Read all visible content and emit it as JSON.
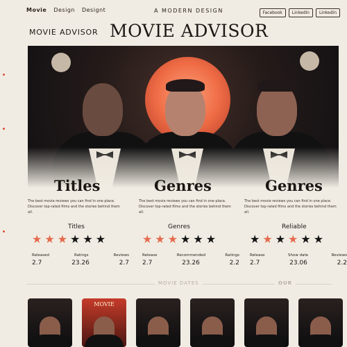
{
  "nav": {
    "items": [
      "Movie",
      "Design",
      "Designt"
    ],
    "tagline": "A MODERN DESIGN",
    "social": [
      "Facebook",
      "LinkedIn",
      "Linkedin"
    ]
  },
  "brand": {
    "small": "MOVIE ADVISOR",
    "big": "MOVIE ADVISOR"
  },
  "hero": {
    "style": "movie-poster illustration",
    "accent_color": "#ef6c45"
  },
  "columns": [
    {
      "title": "Titles",
      "desc": "The best movie reviews you can find in one place. Discover top-rated films and the stories behind them all.",
      "sub": "Titles",
      "stars": 3,
      "stat_labels": [
        "Released",
        "Ratings",
        "Reviews"
      ],
      "stat_values": [
        "2.7",
        "23.26",
        "2.7"
      ]
    },
    {
      "title": "Genres",
      "desc": "The best movie reviews you can find in one place. Discover top-rated films and the stories behind them all.",
      "sub": "Genres",
      "stars": 3,
      "stat_labels": [
        "Release",
        "Recommended",
        "Ratings"
      ],
      "stat_values": [
        "2.7",
        "23.26",
        "2.2"
      ]
    },
    {
      "title": "Genres",
      "desc": "The best movie reviews you can find in one place. Discover top-rated films and the stories behind them all.",
      "sub": "Reliable",
      "stars": 2,
      "stat_labels": [
        "Release",
        "Show date",
        "Reviews"
      ],
      "stat_values": [
        "2.7",
        "23.06",
        "2.2"
      ]
    }
  ],
  "section": {
    "label": "MOVIE DATES",
    "label_right": "OUR"
  },
  "posters": [
    {
      "title": "",
      "style": "dark"
    },
    {
      "title": "MOVIE",
      "style": "red"
    },
    {
      "title": "",
      "style": "dark"
    },
    {
      "title": "",
      "style": "dark"
    },
    {
      "title": "",
      "style": "dark"
    },
    {
      "title": "",
      "style": "dark"
    }
  ],
  "colors": {
    "background": "#f1ece3",
    "accent": "#e46a4d",
    "dark": "#141414"
  }
}
